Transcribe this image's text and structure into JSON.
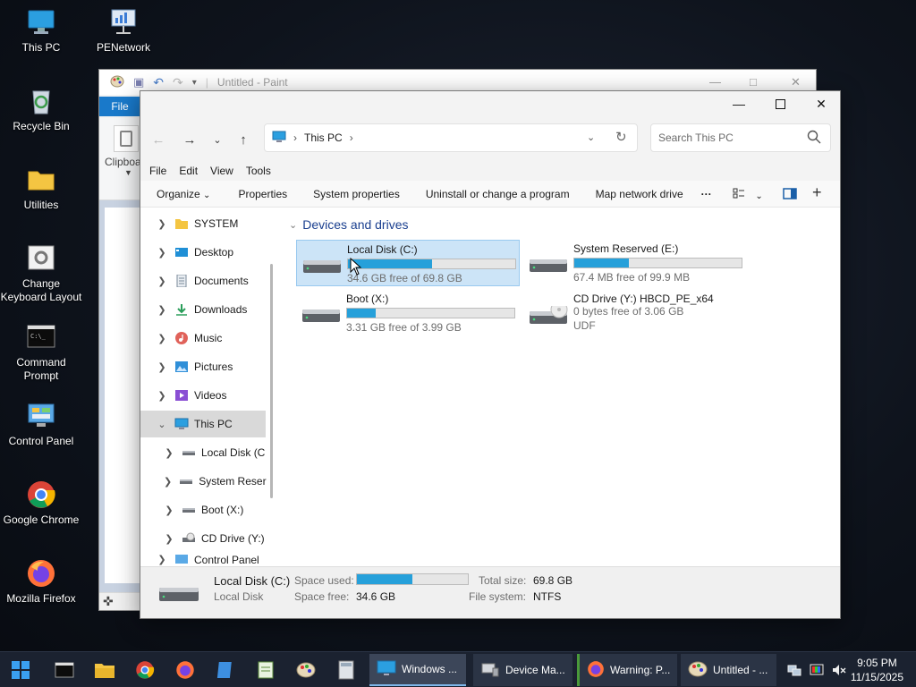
{
  "desktop": {
    "icons": [
      {
        "label": "This PC",
        "icon": "monitor-icon"
      },
      {
        "label": "PENetwork",
        "icon": "network-icon"
      },
      {
        "label": "Recycle Bin",
        "icon": "recycle-bin-icon"
      },
      {
        "label": "Utilities",
        "icon": "folder-icon"
      },
      {
        "label": "Change Keyboard Layout",
        "icon": "keyboard-settings-icon"
      },
      {
        "label": "Command Prompt",
        "icon": "terminal-icon"
      },
      {
        "label": "Control Panel",
        "icon": "control-panel-icon"
      },
      {
        "label": "Google Chrome",
        "icon": "chrome-icon"
      },
      {
        "label": "Mozilla Firefox",
        "icon": "firefox-icon"
      }
    ]
  },
  "paint": {
    "title": "Untitled - Paint",
    "file_tab": "File",
    "clipboard_label": "Clipboa"
  },
  "explorer": {
    "address": {
      "location": "This PC"
    },
    "search": {
      "placeholder": "Search This PC"
    },
    "menu": [
      "File",
      "Edit",
      "View",
      "Tools"
    ],
    "commands": {
      "organize": "Organize",
      "properties": "Properties",
      "system_properties": "System properties",
      "uninstall": "Uninstall or change a program",
      "map_drive": "Map network drive",
      "more": "···"
    },
    "nav": [
      {
        "label": "SYSTEM",
        "icon": "folder-icon",
        "expanded": false
      },
      {
        "label": "Desktop",
        "icon": "desktop-icon",
        "expanded": false
      },
      {
        "label": "Documents",
        "icon": "documents-icon",
        "expanded": false
      },
      {
        "label": "Downloads",
        "icon": "downloads-icon",
        "expanded": false
      },
      {
        "label": "Music",
        "icon": "music-icon",
        "expanded": false
      },
      {
        "label": "Pictures",
        "icon": "pictures-icon",
        "expanded": false
      },
      {
        "label": "Videos",
        "icon": "videos-icon",
        "expanded": false
      },
      {
        "label": "This PC",
        "icon": "monitor-icon",
        "expanded": true,
        "selected": true
      },
      {
        "label": "Local Disk (C",
        "icon": "drive-icon",
        "expanded": false
      },
      {
        "label": "System Reser",
        "icon": "drive-icon",
        "expanded": false
      },
      {
        "label": "Boot (X:)",
        "icon": "drive-icon",
        "expanded": false
      },
      {
        "label": "CD Drive (Y:)",
        "icon": "cd-drive-icon",
        "expanded": false
      },
      {
        "label": "Control Panel",
        "icon": "control-panel-icon",
        "expanded": false
      }
    ],
    "section_title": "Devices and drives",
    "drives": [
      {
        "name": "Local Disk (C:)",
        "free": "34.6 GB free of 69.8 GB",
        "used_fraction": 0.504,
        "selected": true,
        "icon": "hard-drive-icon"
      },
      {
        "name": "System Reserved (E:)",
        "free": "67.4 MB free of 99.9 MB",
        "used_fraction": 0.325,
        "selected": false,
        "icon": "hard-drive-icon"
      },
      {
        "name": "Boot (X:)",
        "free": "3.31 GB free of 3.99 GB",
        "used_fraction": 0.17,
        "selected": false,
        "icon": "hard-drive-icon"
      },
      {
        "name": "CD Drive (Y:) HBCD_PE_x64",
        "free": "0 bytes free of 3.06 GB",
        "fs": "UDF",
        "selected": false,
        "icon": "cd-drive-icon"
      }
    ],
    "details": {
      "name": "Local Disk (C:)",
      "type": "Local Disk",
      "space_used_label": "Space used:",
      "space_free_label": "Space free:",
      "space_free": "34.6 GB",
      "used_fraction": 0.504,
      "total_size_label": "Total size:",
      "total_size": "69.8 GB",
      "file_system_label": "File system:",
      "file_system": "NTFS"
    }
  },
  "taskbar": {
    "tasks": [
      {
        "label": "Windows ...",
        "icon": "explorer-icon",
        "active": true
      },
      {
        "label": "Device Ma...",
        "icon": "device-manager-icon",
        "active": false
      },
      {
        "label": "Warning: P...",
        "icon": "firefox-icon",
        "active": false
      },
      {
        "label": "Untitled - ...",
        "icon": "paint-icon",
        "active": false
      }
    ],
    "time": "9:05 PM",
    "date": "11/15/2025"
  },
  "colors": {
    "accent": "#26a0da",
    "selection": "#cce4f7",
    "taskbar": "#1b2230",
    "paint_file_tab": "#1979ca"
  }
}
